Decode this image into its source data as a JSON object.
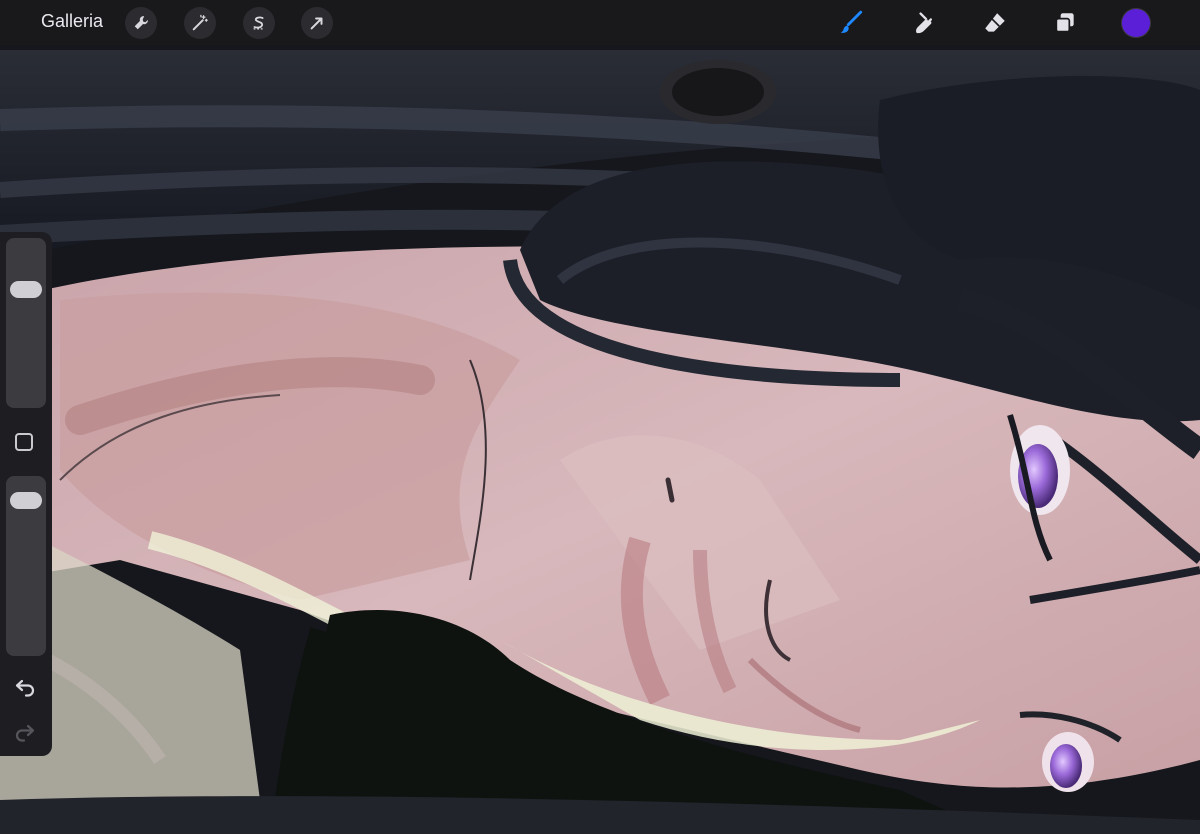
{
  "topbar": {
    "gallery_label": "Galleria",
    "left_tools": [
      {
        "name": "actions",
        "icon": "wrench-icon"
      },
      {
        "name": "adjustments",
        "icon": "magic-wand-icon"
      },
      {
        "name": "selection",
        "icon": "selection-s-icon"
      },
      {
        "name": "transform",
        "icon": "arrow-cursor-icon"
      }
    ],
    "right_tools": [
      {
        "name": "brush",
        "icon": "brush-icon",
        "active": true
      },
      {
        "name": "smudge",
        "icon": "smudge-finger-icon"
      },
      {
        "name": "eraser",
        "icon": "eraser-icon"
      },
      {
        "name": "layers",
        "icon": "layers-icon"
      }
    ],
    "current_color": "#5a1fd6",
    "accent_color": "#1e88ff"
  },
  "sidebar": {
    "brush_size_level": 0.73,
    "opacity_level": 0.92,
    "icons": [
      "modify-square-icon",
      "undo-icon",
      "redo-icon"
    ]
  }
}
